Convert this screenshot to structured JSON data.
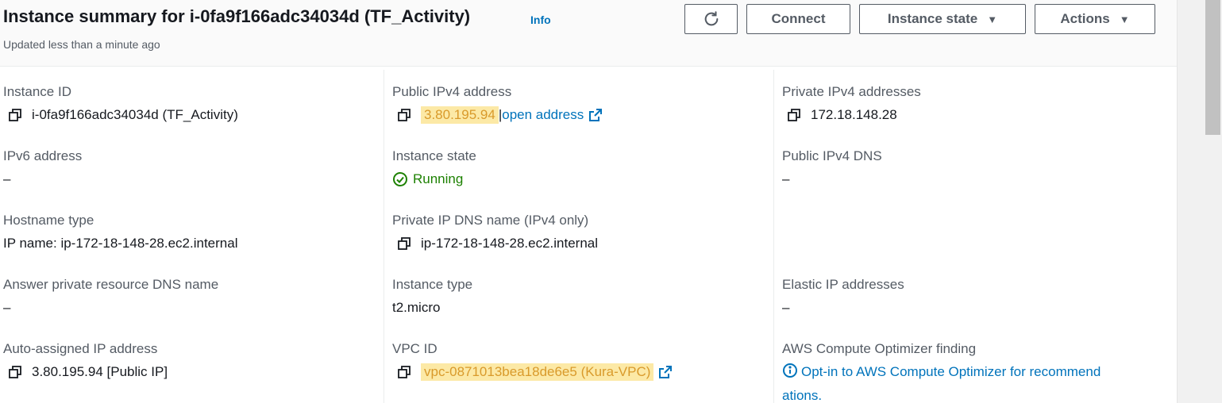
{
  "header": {
    "title": "Instance summary for i-0fa9f166adc34034d (TF_Activity)",
    "info": "Info",
    "updated": "Updated less than a minute ago",
    "buttons": {
      "connect": "Connect",
      "instance_state": "Instance state",
      "actions": "Actions"
    }
  },
  "col1": {
    "instance_id": {
      "label": "Instance ID",
      "value": "i-0fa9f166adc34034d (TF_Activity)"
    },
    "ipv6": {
      "label": "IPv6 address",
      "value": "–"
    },
    "hostname": {
      "label": "Hostname type",
      "value": "IP name: ip-172-18-148-28.ec2.internal"
    },
    "answer_dns": {
      "label": "Answer private resource DNS name",
      "value": "–"
    },
    "auto_ip": {
      "label": "Auto-assigned IP address",
      "value": "3.80.195.94 [Public IP]"
    }
  },
  "col2": {
    "public_ipv4": {
      "label": "Public IPv4 address",
      "ip": "3.80.195.94",
      "sep": "|",
      "link": "open address"
    },
    "state": {
      "label": "Instance state",
      "value": "Running"
    },
    "private_dns": {
      "label": "Private IP DNS name (IPv4 only)",
      "value": "ip-172-18-148-28.ec2.internal"
    },
    "type": {
      "label": "Instance type",
      "value": "t2.micro"
    },
    "vpc": {
      "label": "VPC ID",
      "value": "vpc-0871013bea18de6e5 (Kura-VPC)"
    }
  },
  "col3": {
    "private_ipv4": {
      "label": "Private IPv4 addresses",
      "value": "172.18.148.28"
    },
    "public_dns": {
      "label": "Public IPv4 DNS",
      "value": "–"
    },
    "elastic_ip": {
      "label": "Elastic IP addresses",
      "value": "–"
    },
    "optimizer": {
      "label": "AWS Compute Optimizer finding",
      "line1": "Opt-in to AWS Compute Optimizer for recommend",
      "line2": "ations."
    }
  },
  "colors": {
    "link": "#0073bb",
    "running": "#1d8102",
    "highlight_bg": "#fce9a6",
    "highlight_text": "#d99a2b",
    "label": "#545b64"
  },
  "icons": [
    "refresh-icon",
    "caret-down-icon",
    "copy-icon",
    "external-link-icon",
    "check-circle-icon",
    "info-circle-icon"
  ]
}
